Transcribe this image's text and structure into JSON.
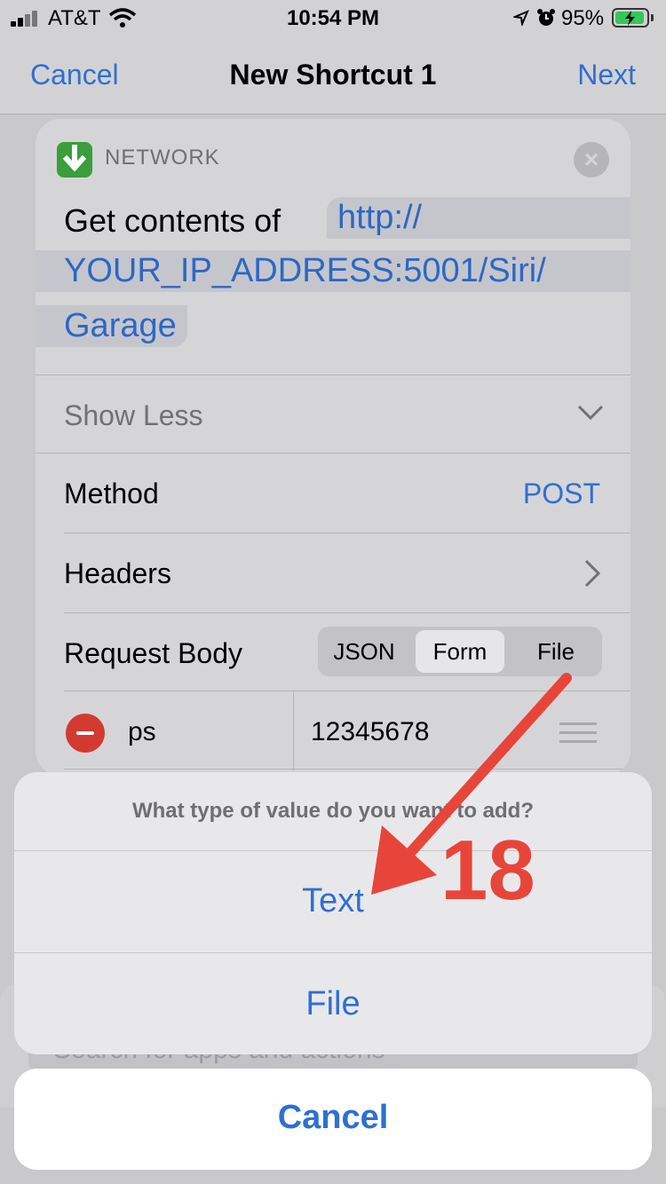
{
  "status_bar": {
    "carrier": "AT&T",
    "time": "10:54 PM",
    "battery_percent": "95%",
    "battery_level": 0.95
  },
  "nav": {
    "cancel_label": "Cancel",
    "title": "New Shortcut 1",
    "next_label": "Next"
  },
  "action_card": {
    "category": "NETWORK",
    "close_icon": "×",
    "get_contents_label": "Get contents of",
    "url_lines": [
      "http://",
      "YOUR_IP_ADDRESS:5001/Siri/",
      "Garage"
    ],
    "show_less_label": "Show Less",
    "method_label": "Method",
    "method_value": "POST",
    "headers_label": "Headers",
    "request_body_label": "Request Body",
    "body_types": [
      "JSON",
      "Form",
      "File"
    ],
    "selected_body_type": "Form",
    "form_rows": [
      {
        "key": "ps",
        "value": "12345678"
      }
    ]
  },
  "background_search_placeholder": "Search for apps and actions",
  "action_sheet": {
    "title": "What type of value do you want to add?",
    "options": [
      "Text",
      "File"
    ],
    "cancel_label": "Cancel"
  },
  "annotation": {
    "step_number": "18",
    "color": "#e8453a"
  },
  "colors": {
    "accent": "#2f6fd1",
    "destructive": "#d23a31",
    "network_icon": "#3a9e3a"
  }
}
